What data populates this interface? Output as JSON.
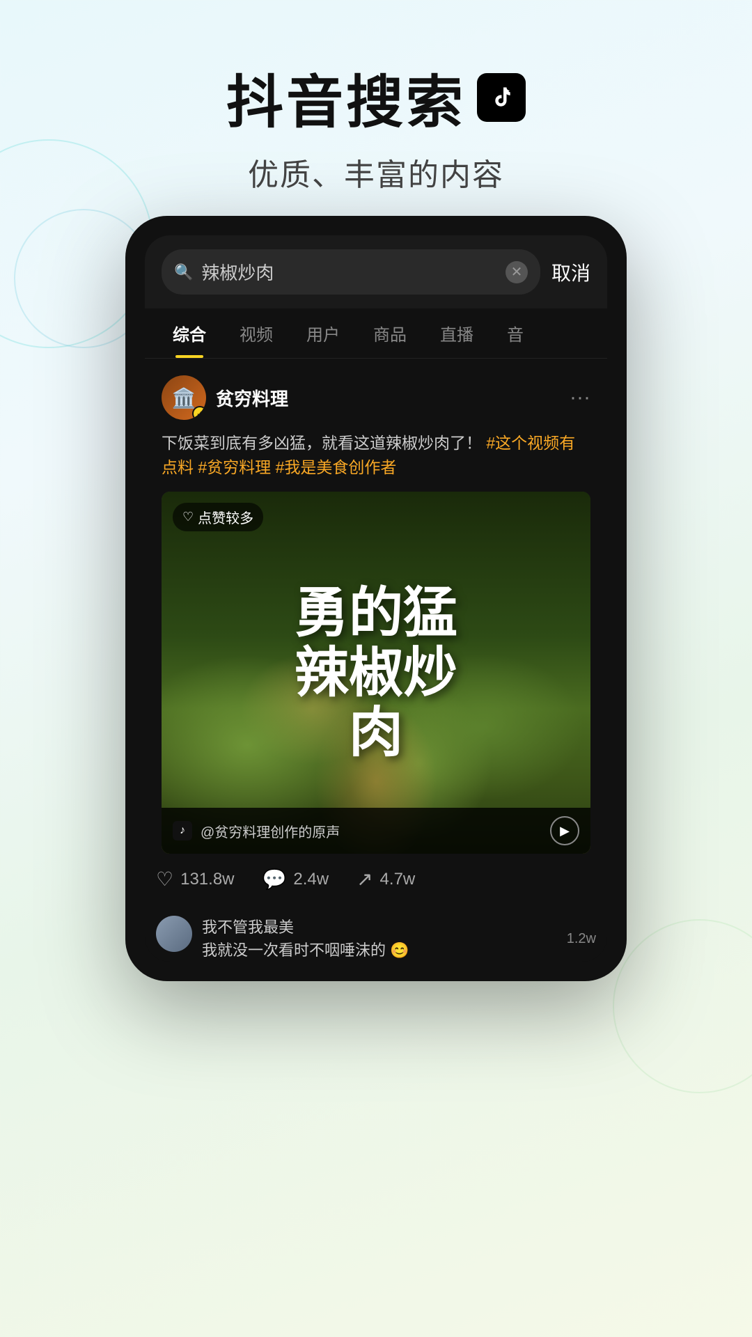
{
  "header": {
    "title": "抖音搜索",
    "tiktok_logo": "♪",
    "subtitle": "优质、丰富的内容"
  },
  "search": {
    "query": "辣椒炒肉",
    "cancel_label": "取消",
    "placeholder": "辣椒炒肉"
  },
  "tabs": [
    {
      "label": "综合",
      "active": true
    },
    {
      "label": "视频",
      "active": false
    },
    {
      "label": "用户",
      "active": false
    },
    {
      "label": "商品",
      "active": false
    },
    {
      "label": "直播",
      "active": false
    },
    {
      "label": "音",
      "active": false
    }
  ],
  "post": {
    "author_name": "贫穷料理",
    "author_emoji": "🏛️",
    "author_verified": true,
    "text_normal": "下饭菜到底有多凶猛，就看这道辣椒炒肉了！",
    "hashtags": [
      "#这个视频有点料",
      "#贫穷料理",
      "#我是美食创作者"
    ],
    "video_label": "点赞较多",
    "video_title": "勇\n的猛\n辣\n椒炒\n肉",
    "audio_text": "@贫穷料理创作的原声",
    "stats": [
      {
        "icon": "♡",
        "value": "131.8w"
      },
      {
        "icon": "💬",
        "value": "2.4w"
      },
      {
        "icon": "↗",
        "value": "4.7w"
      }
    ]
  },
  "comments": [
    {
      "text": "我不管我最美",
      "subtext": "我就没一次看时不咽唾沫的 😊",
      "count": "1.2w"
    }
  ],
  "colors": {
    "accent": "#f9d423",
    "bg_dark": "#111111",
    "hashtag_color": "#f9a825"
  }
}
